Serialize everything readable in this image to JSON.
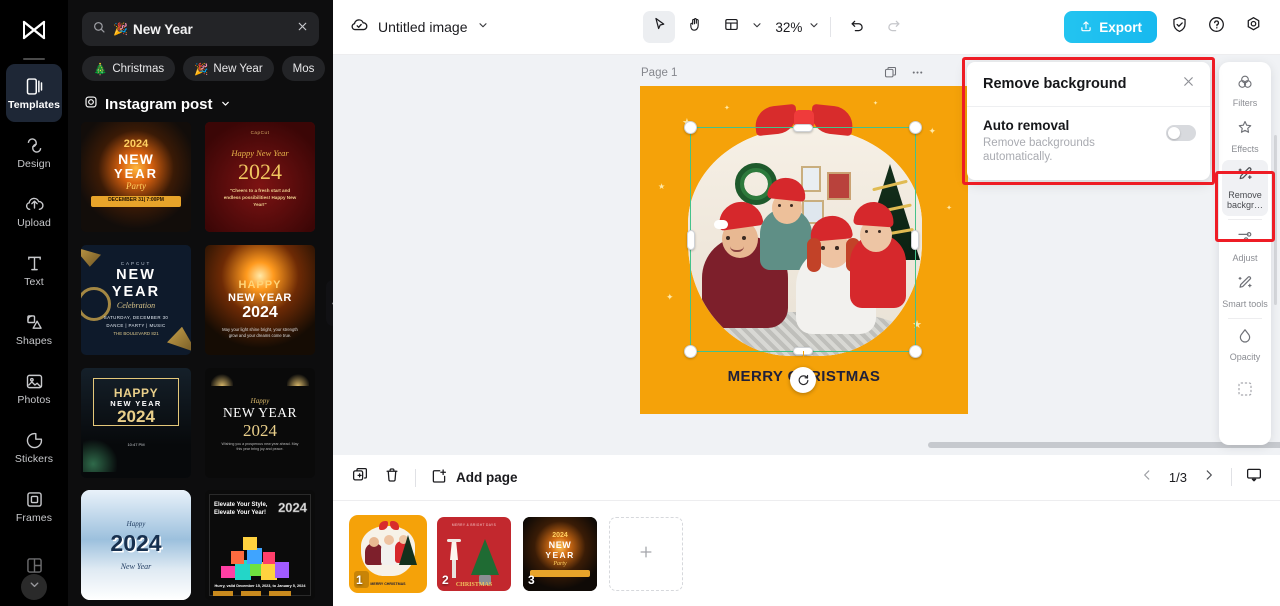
{
  "app": {
    "name": "CapCut Image Editor"
  },
  "left_rail": {
    "logo": "capcut-logo",
    "items": [
      {
        "label": "Templates",
        "icon": "templates-icon",
        "active": true
      },
      {
        "label": "Design",
        "icon": "design-icon",
        "active": false
      },
      {
        "label": "Upload",
        "icon": "upload-icon",
        "active": false
      },
      {
        "label": "Text",
        "icon": "text-icon",
        "active": false
      },
      {
        "label": "Shapes",
        "icon": "shapes-icon",
        "active": false
      },
      {
        "label": "Photos",
        "icon": "photos-icon",
        "active": false
      },
      {
        "label": "Stickers",
        "icon": "stickers-icon",
        "active": false
      },
      {
        "label": "Frames",
        "icon": "frames-icon",
        "active": false
      },
      {
        "label": "",
        "icon": "layouts-icon",
        "active": false
      }
    ],
    "expand_icon": "chevron-down-icon"
  },
  "panel": {
    "search": {
      "value": "New Year",
      "emoji": "🎉",
      "icon": "search-icon",
      "clear_icon": "close-icon"
    },
    "chips": [
      {
        "label": "Christmas",
        "emoji": "🎄"
      },
      {
        "label": "New Year",
        "emoji": "🎉"
      },
      {
        "label": "Mos",
        "emoji": ""
      }
    ],
    "category": {
      "label": "Instagram post",
      "icon": "instagram-icon",
      "chevron": "chevron-down-icon"
    },
    "templates": [
      {
        "name": "2024 New Year Party",
        "title": "2024",
        "sub1": "NEW",
        "sub2": "YEAR",
        "sub3": "Party",
        "banner": "DECEMBER 31| 7:00PM",
        "bg": "#120d0a",
        "accent": "#ffbf2e"
      },
      {
        "name": "Happy New Year 2024 maroon",
        "title": "2024",
        "sub1": "Happy New Year",
        "sub2": "\"Cheers to a fresh start and endless possibilities! Happy New Year!\"",
        "bg": "#5a0d0d",
        "accent": "#e9b64b"
      },
      {
        "name": "New Year Celebration navy",
        "title": "NEW",
        "sub1": "YEAR",
        "sub2": "Celebration",
        "sub3": "SATURDAY, DECEMBER 30",
        "bg": "#0e1a2b",
        "accent": "#d8c48a"
      },
      {
        "name": "Happy New Year 2024 fireworks",
        "title": "HAPPY",
        "sub1": "NEW YEAR",
        "sub2": "2024",
        "bg": "#1a1006",
        "accent": "#ffd477"
      },
      {
        "name": "Happy New Year 2024 gold frame",
        "title": "HAPPY",
        "sub1": "NEW YEAR",
        "sub2": "2024",
        "bg": "#0c0f12",
        "accent": "#e4c87a"
      },
      {
        "name": "Happy New Year 2024 black gold",
        "title": "NEW YEAR",
        "sub1": "Happy",
        "sub2": "2024",
        "bg": "#0a0a0a",
        "accent": "#e9cf8a"
      },
      {
        "name": "2024 New Year snow",
        "title": "2024",
        "sub1": "Happy",
        "sub2": "New Year",
        "bg": "#cfe2f2",
        "accent": "#1e3a5f"
      },
      {
        "name": "Elevate Your Style gifts",
        "title": "Elevate Your Style,",
        "sub1": "Elevate Your Year!",
        "sub2": "2024",
        "sub3": "Hurry, valid December 15, 2023, to January 5, 2024",
        "bg": "#0b0b0b",
        "accent": "#ffffff"
      }
    ],
    "collapse_handle": "panel-collapse-handle"
  },
  "topbar": {
    "cloud_icon": "cloud-saved-icon",
    "doc_title": "Untitled image",
    "title_chevron": "chevron-down-icon",
    "select_tool": "cursor-tool-icon",
    "hand_tool": "hand-tool-icon",
    "layout_tool": "layout-tool-icon",
    "layout_chevron": "chevron-down-icon",
    "zoom": "32%",
    "zoom_chevron": "chevron-down-icon",
    "undo": "undo-icon",
    "redo": "redo-icon",
    "export_label": "Export",
    "export_icon": "export-icon",
    "shield_icon": "shield-icon",
    "help_icon": "help-icon",
    "settings_icon": "settings-icon",
    "export_color": "#17b9ef"
  },
  "canvas": {
    "page_label": "Page 1",
    "duplicate_page_icon": "duplicate-icon",
    "more_icon": "more-horizontal-icon",
    "artboard_bg": "#f5a209",
    "caption": "MERRY CHRISTMAS",
    "selection_color": "#44c28b",
    "float_toolbar": [
      {
        "icon": "cutout-icon",
        "name": "cutout"
      },
      {
        "icon": "replace-icon",
        "name": "replace"
      },
      {
        "icon": "duplicate-icon",
        "name": "duplicate"
      },
      {
        "icon": "more-horizontal-icon",
        "name": "more"
      }
    ],
    "rotate_handle": "rotate-icon"
  },
  "remove_bg_panel": {
    "title": "Remove background",
    "close_icon": "close-icon",
    "option_label": "Auto removal",
    "option_desc": "Remove backgrounds automatically.",
    "toggle_state": "off",
    "highlight_color": "#ee1c25"
  },
  "right_rail": {
    "items": [
      {
        "label": "Filters",
        "icon": "filters-icon",
        "active": false
      },
      {
        "label": "Effects",
        "icon": "effects-icon",
        "active": false
      },
      {
        "label": "Remove backgr…",
        "icon": "remove-background-icon",
        "active": true
      },
      {
        "label": "Adjust",
        "icon": "adjust-icon",
        "active": false
      },
      {
        "label": "Smart tools",
        "icon": "smart-tools-icon",
        "active": false
      },
      {
        "label": "Opacity",
        "icon": "opacity-icon",
        "active": false
      },
      {
        "label": "",
        "icon": "crop-icon",
        "active": false
      }
    ]
  },
  "bottombar": {
    "duplicate_icon": "duplicate-page-icon",
    "delete_icon": "delete-icon",
    "add_page_label": "Add page",
    "add_page_icon": "add-page-icon",
    "pages": [
      {
        "number": "1",
        "name": "Merry Christmas family",
        "bg": "#f5a209",
        "active": true,
        "caption": "MERRY CHRISTMAS"
      },
      {
        "number": "2",
        "name": "Christmas tree red",
        "bg": "#c2282e",
        "active": false,
        "caption": "CHRISTMAS"
      },
      {
        "number": "3",
        "name": "2024 New Year party",
        "bg": "#0f0a06",
        "active": false,
        "caption": "NEW YEAR"
      }
    ],
    "add_thumb_icon": "plus-icon",
    "pager": {
      "prev_icon": "chevron-left-icon",
      "value": "1/3",
      "next_icon": "chevron-right-icon",
      "present_icon": "present-icon"
    }
  }
}
